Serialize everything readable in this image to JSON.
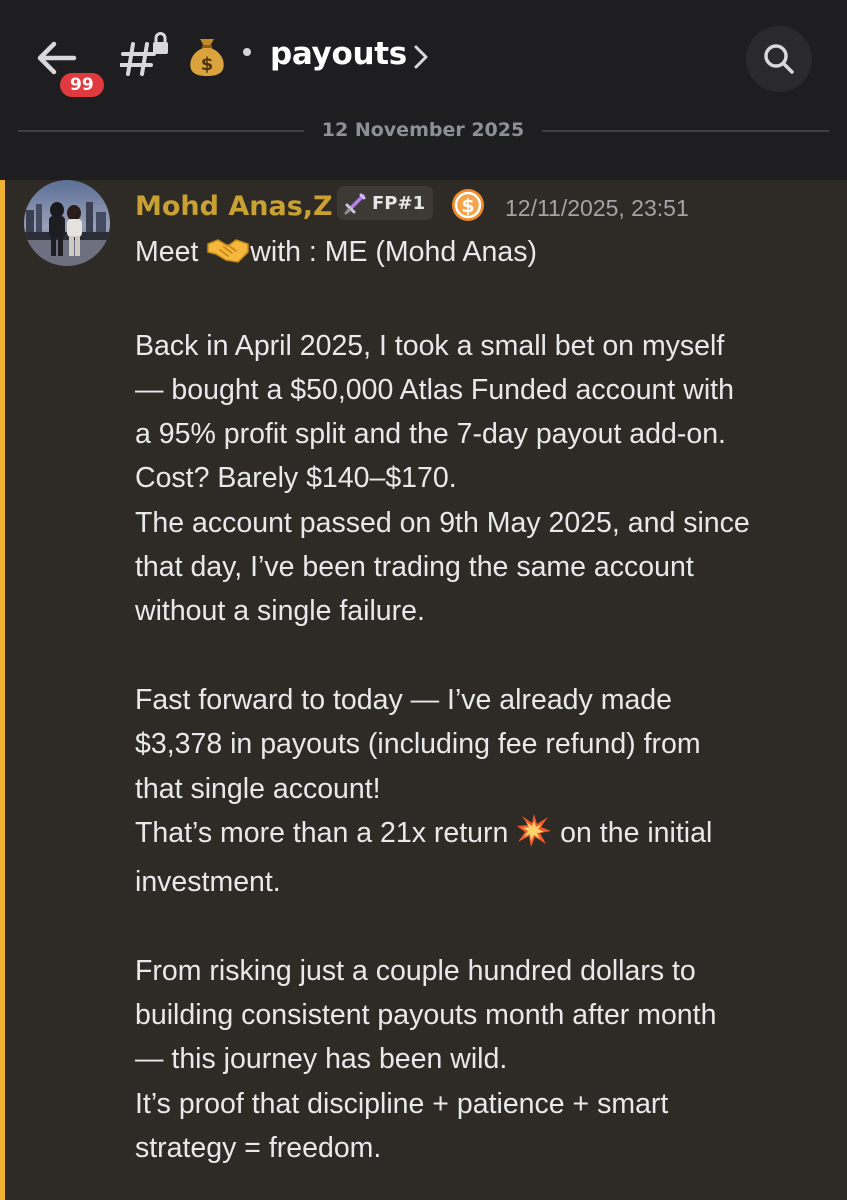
{
  "header": {
    "unread_count": "99",
    "channel_emoji": "money-bag-icon",
    "channel_name": "payouts",
    "date_divider": "12 November 2025"
  },
  "message": {
    "author": "Mohd Anas,Z",
    "role_tag": "FP#1",
    "timestamp": "12/11/2025, 23:51",
    "lines": [
      {
        "text": "Meet "
      },
      {
        "text": "with : ME (Mohd Anas)"
      },
      {
        "text": "Back in April 2025, I took a small bet on myself"
      },
      {
        "text": "— bought a $50,000 Atlas Funded account with"
      },
      {
        "text": "a 95% profit split and the 7-day payout add-on."
      },
      {
        "text": "Cost? Barely $140–$170."
      },
      {
        "text": "The account passed on 9th May 2025, and since"
      },
      {
        "text": "that day, I’ve been trading the same account"
      },
      {
        "text": "without a single failure."
      },
      {
        "text": "Fast forward to today — I’ve already made"
      },
      {
        "text": "$3,378 in payouts (including fee refund) from"
      },
      {
        "text": "that single account!"
      },
      {
        "text": "That’s more than a 21x return "
      },
      {
        "text": " on the initial"
      },
      {
        "text": "investment."
      },
      {
        "text": "From risking just a couple hundred dollars to"
      },
      {
        "text": "building consistent payouts month after month"
      },
      {
        "text": "— this journey has been wild."
      },
      {
        "text": "It’s proof that discipline + patience + smart"
      },
      {
        "text": "strategy = freedom."
      }
    ]
  },
  "colors": {
    "header_bg": "#1e1e21",
    "message_bg": "#2e2b26",
    "mention_bar": "#f0b232",
    "username": "#c9a032",
    "badge": "#e0393e"
  }
}
